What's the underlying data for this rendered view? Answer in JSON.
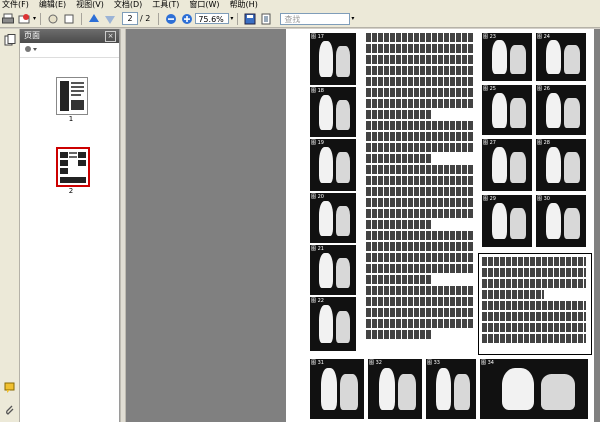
{
  "menu": [
    "文件(F)",
    "编辑(E)",
    "视图(V)",
    "文档(D)",
    "工具(T)",
    "窗口(W)",
    "帮助(H)"
  ],
  "toolbar": {
    "current_page": "2",
    "page_total": "/ 2",
    "zoom": "75.6%",
    "search_placeholder": "查找"
  },
  "panel": {
    "title": "页面",
    "thumbnails": [
      {
        "label": "1",
        "selected": false
      },
      {
        "label": "2",
        "selected": true
      }
    ]
  },
  "photo_captions": [
    "图 17",
    "图 18",
    "图 19",
    "图 20",
    "图 21",
    "图 22",
    "图 23",
    "图 24",
    "图 25",
    "图 26",
    "图 27",
    "图 28",
    "图 29",
    "图 30",
    "图 31",
    "图 32",
    "图 33",
    "图 34"
  ]
}
